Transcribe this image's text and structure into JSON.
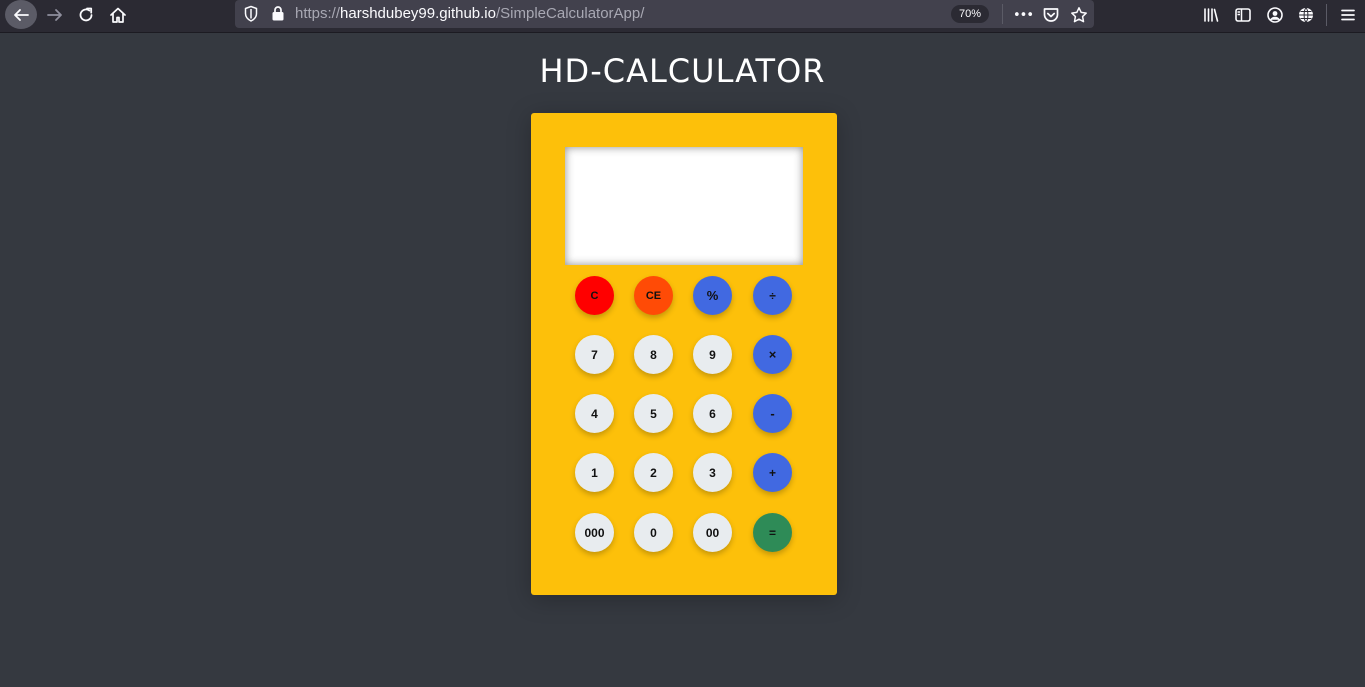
{
  "browser": {
    "url_scheme": "https://",
    "url_host": "harshdubey99.github.io",
    "url_path": "/SimpleCalculatorApp/",
    "zoom": "70%",
    "more_label": "•••",
    "colors": {
      "toolbar": "#2b2a33",
      "urlbar": "#42414d"
    }
  },
  "page": {
    "title": "HD-CALCULATOR",
    "colors": {
      "background": "#353940",
      "calculator": "#fdc00a"
    }
  },
  "calculator": {
    "display_value": "",
    "keys": {
      "clear": "C",
      "clear_entry": "CE",
      "percent": "%",
      "divide": "÷",
      "seven": "7",
      "eight": "8",
      "nine": "9",
      "multiply": "×",
      "four": "4",
      "five": "5",
      "six": "6",
      "subtract": "-",
      "one": "1",
      "two": "2",
      "three": "3",
      "add": "+",
      "triple_zero": "000",
      "zero": "0",
      "double_zero": "00",
      "equals": "="
    },
    "colors": {
      "number": "#e8ecef",
      "operator": "#4169e1",
      "clear": "#ff0000",
      "clear_entry": "#ff4b06",
      "equals": "#2e8b57"
    }
  }
}
